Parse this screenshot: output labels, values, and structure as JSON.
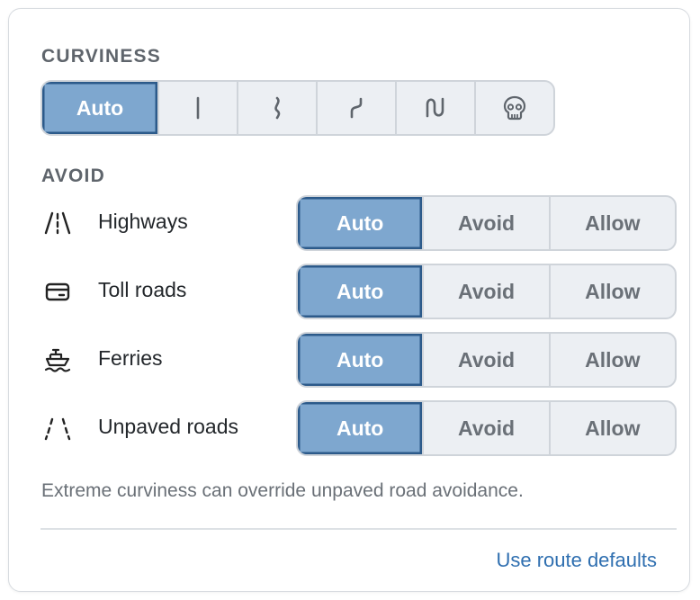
{
  "curviness": {
    "label": "CURVINESS",
    "options": [
      {
        "label": "Auto",
        "icon": null,
        "active": true
      },
      {
        "label": "",
        "icon": "straight-line-icon",
        "active": false
      },
      {
        "label": "",
        "icon": "slight-curve-icon",
        "active": false
      },
      {
        "label": "",
        "icon": "curvy-icon",
        "active": false
      },
      {
        "label": "",
        "icon": "hairpin-icon",
        "active": false
      },
      {
        "label": "",
        "icon": "skull-icon",
        "active": false
      }
    ]
  },
  "avoid": {
    "label": "AVOID",
    "rows": [
      {
        "label": "Highways",
        "icon": "highway-icon",
        "options": [
          "Auto",
          "Avoid",
          "Allow"
        ],
        "selected": "Auto"
      },
      {
        "label": "Toll roads",
        "icon": "toll-card-icon",
        "options": [
          "Auto",
          "Avoid",
          "Allow"
        ],
        "selected": "Auto"
      },
      {
        "label": "Ferries",
        "icon": "ferry-icon",
        "options": [
          "Auto",
          "Avoid",
          "Allow"
        ],
        "selected": "Auto"
      },
      {
        "label": "Unpaved roads",
        "icon": "unpaved-road-icon",
        "options": [
          "Auto",
          "Avoid",
          "Allow"
        ],
        "selected": "Auto"
      }
    ]
  },
  "note": "Extreme curviness can override unpaved road avoidance.",
  "footer": {
    "reset_label": "Use route defaults"
  },
  "colors": {
    "accent": "#7ea7cf",
    "accent_border": "#2c5a8a",
    "link": "#2f6fb0"
  }
}
